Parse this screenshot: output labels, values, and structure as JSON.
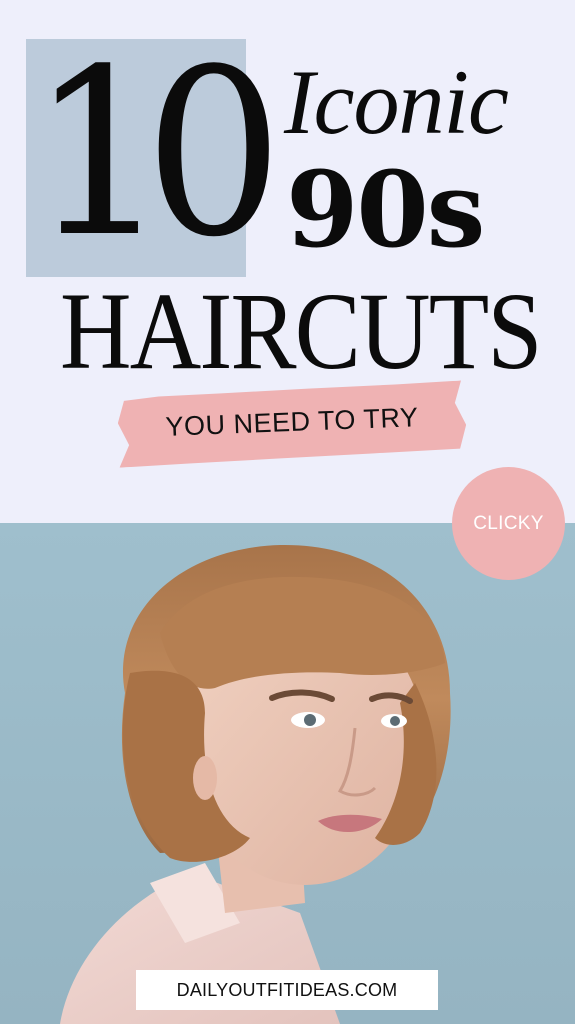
{
  "headline": {
    "number": "10",
    "line1": "Iconic",
    "line2": "90s",
    "line3": "HAIRCUTS"
  },
  "banner": {
    "label": "YOU NEED TO TRY"
  },
  "badge": {
    "label": "CLICKY"
  },
  "footer": {
    "website": "DAILYOUTFITIDEAS.COM"
  },
  "colors": {
    "top_background": "#eeeffb",
    "number_box": "#bccbdb",
    "accent_pink": "#efb2b3",
    "photo_background": "#9fbfcd",
    "hair": "#b07a4e"
  },
  "photo": {
    "icon": "portrait-illustration"
  }
}
